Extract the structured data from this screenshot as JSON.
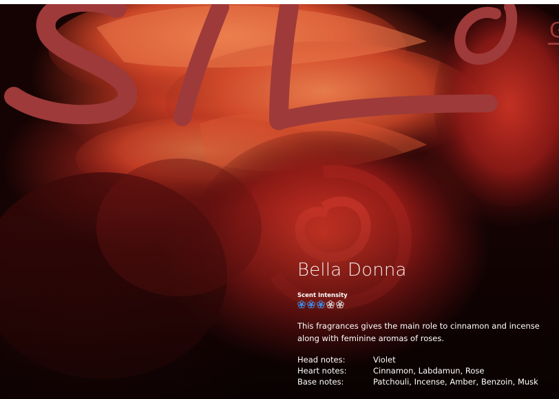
{
  "product": {
    "name": "Bella Donna",
    "intensity_label": "Scent Intensity",
    "intensity_value": 3,
    "intensity_max": 5,
    "description": "This fragrances gives the main role to cinnamon and incense along with feminine aromas of roses.",
    "notes": [
      {
        "key": "Head notes:",
        "value": "Violet"
      },
      {
        "key": "Heart notes:",
        "value": "Cinnamon, Labdamun, Rose"
      },
      {
        "key": "Base notes:",
        "value": "Patchouli, Incense, Amber, Benzoin, Musk"
      }
    ]
  },
  "colors": {
    "intensity_active": "#3a8ee8",
    "intensity_inactive": "#d8d8d8",
    "script_lettering": "#9e3a3a"
  }
}
